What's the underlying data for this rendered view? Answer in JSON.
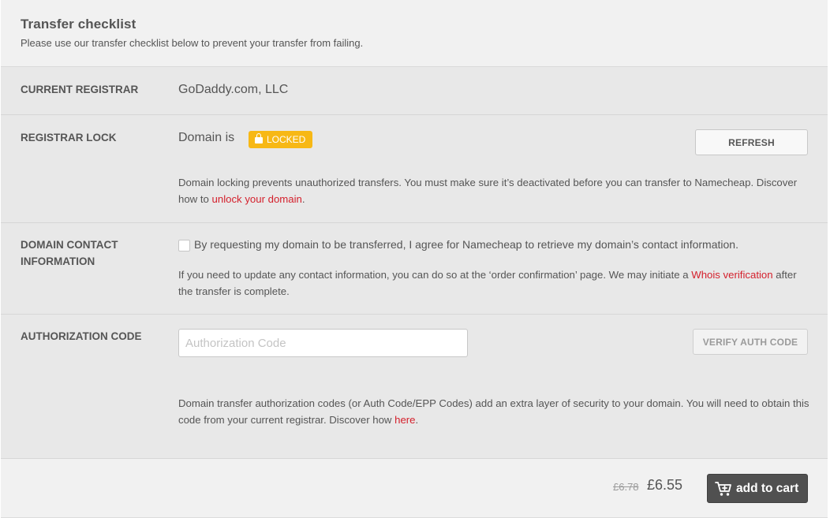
{
  "header": {
    "title": "Transfer checklist",
    "subtitle": "Please use our transfer checklist below to prevent your transfer from failing."
  },
  "current_registrar": {
    "label": "CURRENT REGISTRAR",
    "value": "GoDaddy.com, LLC"
  },
  "registrar_lock": {
    "label": "REGISTRAR LOCK",
    "status_prefix": "Domain is",
    "status_badge": "LOCKED",
    "refresh_button": "REFRESH",
    "description": "Domain locking prevents unauthorized transfers. You must make sure it’s deactivated before you can transfer to Namecheap. Discover how to",
    "link_text": "unlock your domain",
    "after_link": ".",
    "badge_color": "#f7b815"
  },
  "domain_contact": {
    "label_line1": "DOMAIN CONTACT",
    "label_line2": "INFORMATION",
    "checkbox_label": "By requesting my domain to be transferred, I agree for Namecheap to retrieve my domain’s contact information.",
    "checked": false,
    "description": "If you need to update any contact information, you can do so at the ‘order confirmation’ page. We may initiate a",
    "link_text": "Whois verification",
    "after_link": "after the transfer is complete."
  },
  "authorization": {
    "label": "AUTHORIZATION CODE",
    "input_placeholder": "Authorization Code",
    "input_value": "",
    "verify_button": "VERIFY AUTH CODE",
    "description": "Domain transfer authorization codes (or Auth Code/EPP Codes) add an extra layer of security to your domain. You will need to obtain this code from your current registrar. Discover how",
    "link_text": "here",
    "after_link": "."
  },
  "footer": {
    "old_price": "£6.78",
    "price": "£6.55",
    "cart_button": "add to cart",
    "cart_icon": "cart-plus-icon"
  },
  "colors": {
    "link": "#d4202c",
    "cart_button": "#505050",
    "row_background": "#e8e8e8",
    "panel_background": "#f1f1f1"
  }
}
